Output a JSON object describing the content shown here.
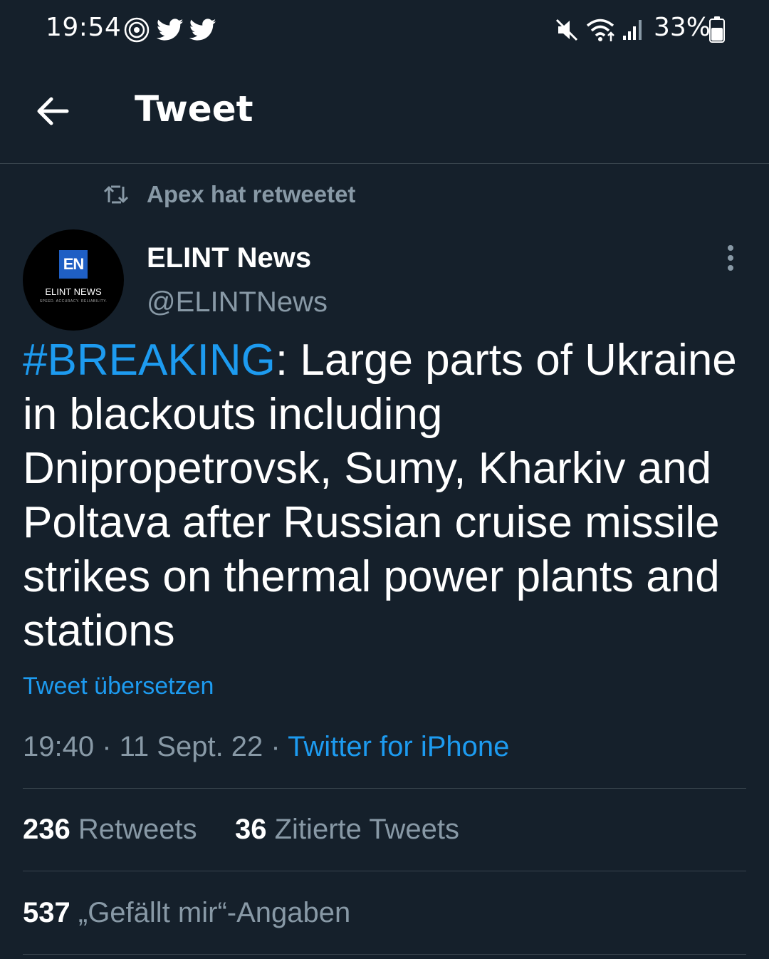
{
  "status_bar": {
    "time": "19:54",
    "left_icons": [
      "radio-icon",
      "twitter-bird-icon",
      "twitter-bird-icon"
    ],
    "right_icons": [
      "mute-icon",
      "wifi-icon",
      "signal-icon",
      "battery-icon"
    ],
    "battery": "33%"
  },
  "header": {
    "back_icon": "arrow-left-icon",
    "title": "Tweet"
  },
  "retweet_context": {
    "icon": "retweet-icon",
    "text": "Apex hat retweetet"
  },
  "author": {
    "avatar": {
      "mark": "EN",
      "name": "ELINT NEWS",
      "tagline": "SPEED. ACCURACY. RELIABILITY."
    },
    "name": "ELINT News",
    "handle": "@ELINTNews",
    "more_icon": "more-vertical-icon"
  },
  "tweet": {
    "hashtag": "#BREAKING",
    "text": ": Large parts of Ukraine in blackouts including Dnipropetrovsk, Sumy, Kharkiv and Poltava after Russian cruise missile strikes on thermal power plants and stations",
    "translate": "Tweet übersetzen",
    "time": "19:40",
    "sep": " · ",
    "date": "11 Sept. 22",
    "source": "Twitter for iPhone"
  },
  "stats": {
    "retweets_count": "236",
    "retweets_label": "Retweets",
    "quotes_count": "36",
    "quotes_label": "Zitierte Tweets",
    "likes_count": "537",
    "likes_label": "„Gefällt mir“-Angaben"
  },
  "colors": {
    "background": "#15202b",
    "accent": "#1d9bf0",
    "secondary_text": "#8899a6",
    "divider": "#38444d"
  }
}
